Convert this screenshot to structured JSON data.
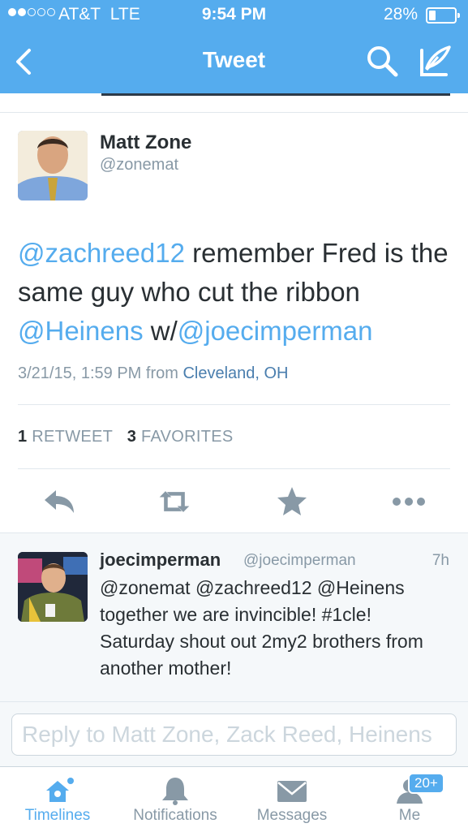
{
  "status_bar": {
    "carrier": "AT&T",
    "network": "LTE",
    "time": "9:54 PM",
    "battery": "28%",
    "signal_level": 0.4,
    "battery_level": 0.28
  },
  "nav": {
    "title": "Tweet",
    "back_icon": "chevron-left-icon",
    "search_icon": "search-icon",
    "compose_icon": "compose-icon"
  },
  "tweet": {
    "author_name": "Matt Zone",
    "author_handle": "@zonemat",
    "text_segments": [
      {
        "text": "@zachreed12",
        "link": true
      },
      {
        "text": " remember Fred is the same guy who cut the ribbon ",
        "link": false
      },
      {
        "text": "@Heinens",
        "link": true
      },
      {
        "text": " w/",
        "link": false
      },
      {
        "text": "@joecimperman",
        "link": true
      }
    ],
    "date": "3/21/15, 1:59 PM from ",
    "place": "Cleveland, OH",
    "retweets_count": "1",
    "retweets_label": "RETWEET",
    "favorites_count": "3",
    "favorites_label": "FAVORITES"
  },
  "actions": [
    {
      "icon": "reply-icon"
    },
    {
      "icon": "retweet-icon"
    },
    {
      "icon": "favorite-star-icon"
    },
    {
      "icon": "more-icon"
    }
  ],
  "reply": {
    "name": "joecimperman",
    "handle": "@joecimperman",
    "time": "7h",
    "text": "@zonemat @zachreed12 @Heinens together we are invincible! #1cle! Saturday shout out 2my2 brothers from another mother!"
  },
  "reply_input": {
    "placeholder": "Reply to Matt Zone, Zack Reed, Heinens"
  },
  "tabbar": {
    "timelines": "Timelines",
    "notifications": "Notifications",
    "messages": "Messages",
    "me": "Me",
    "me_badge": "20+"
  },
  "colors": {
    "brand": "#55acee",
    "text": "#292f33",
    "muted": "#8899a6",
    "place": "#4a7eae"
  }
}
